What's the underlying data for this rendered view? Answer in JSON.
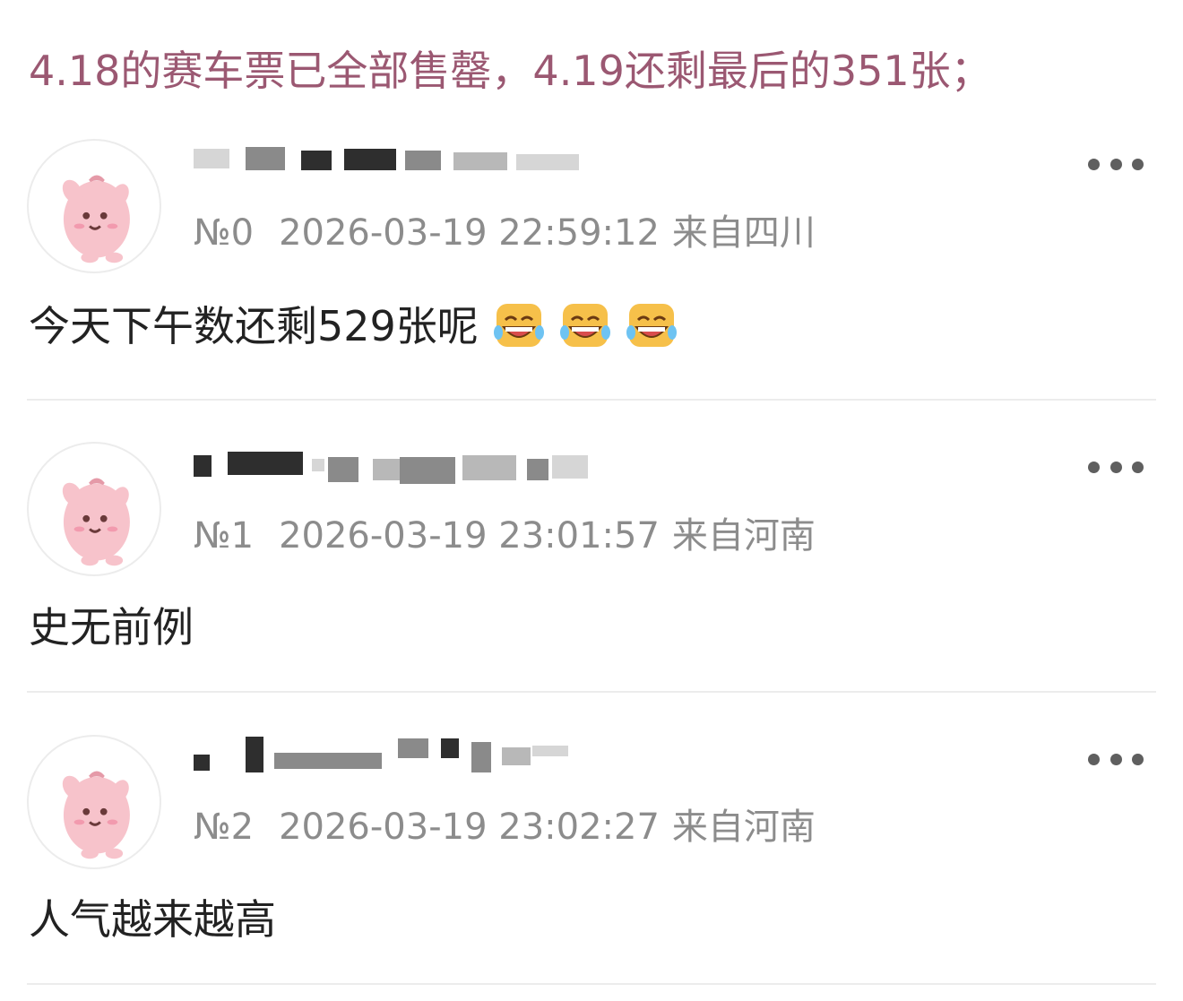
{
  "colors": {
    "title": "#9b5872",
    "meta": "#8c8c8c",
    "text": "#222222",
    "divider": "#ececec"
  },
  "post": {
    "title": "4.18的赛车票已全部售罄，4.19还剩最后的351张；"
  },
  "comments": [
    {
      "floor": "№0",
      "datetime": "2026-03-19 22:59:12",
      "location": "来自四川",
      "text": "今天下午数还剩529张呢",
      "emojis": [
        "laughing-tears-emoji",
        "laughing-tears-emoji",
        "laughing-tears-emoji"
      ]
    },
    {
      "floor": "№1",
      "datetime": "2026-03-19 23:01:57",
      "location": "来自河南",
      "text": "史无前例",
      "emojis": []
    },
    {
      "floor": "№2",
      "datetime": "2026-03-19 23:02:27",
      "location": "来自河南",
      "text": "人气越来越高",
      "emojis": []
    }
  ],
  "icons": {
    "more": "more-dots-icon",
    "avatar": "pink-creature-avatar"
  }
}
